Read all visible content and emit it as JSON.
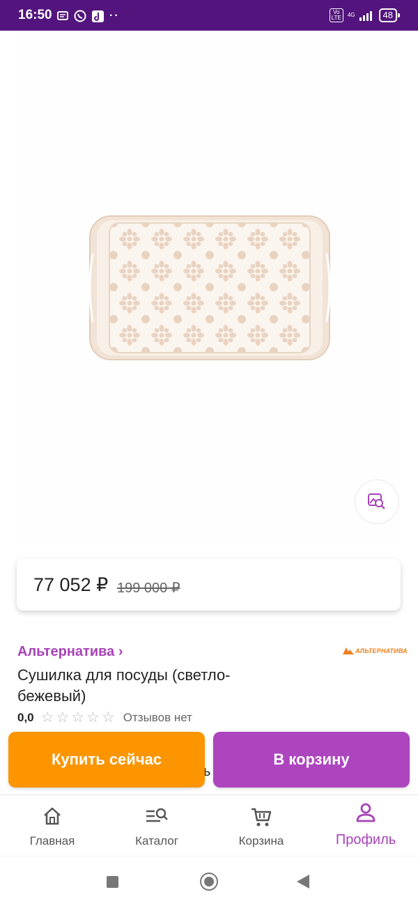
{
  "status_bar": {
    "time": "16:50",
    "network": "4G",
    "battery": "48"
  },
  "price": {
    "current": "77 052 ₽",
    "old": "199 000 ₽"
  },
  "product": {
    "brand": "Альтернатива ›",
    "brand_logo_text": "АЛЬТЕРНАТИВА",
    "title": "Сушилка для посуды (светло-бежевый)",
    "rating": "0,0",
    "reviews": "Отзывов нет",
    "image_color": "#f1e3d6"
  },
  "actions": {
    "buy_now": "Купить сейчас",
    "add_to_cart": "В корзину",
    "partially_hidden_text": "ь"
  },
  "bottom_nav": {
    "items": [
      {
        "label": "Главная",
        "icon": "home-icon"
      },
      {
        "label": "Каталог",
        "icon": "catalog-search-icon"
      },
      {
        "label": "Корзина",
        "icon": "cart-icon"
      },
      {
        "label": "Профиль",
        "icon": "profile-icon",
        "active": true
      }
    ]
  },
  "colors": {
    "status_bar": "#53157d",
    "accent": "#a742b8",
    "buy_button": "#fc9500",
    "cart_button": "#ad45bf"
  }
}
